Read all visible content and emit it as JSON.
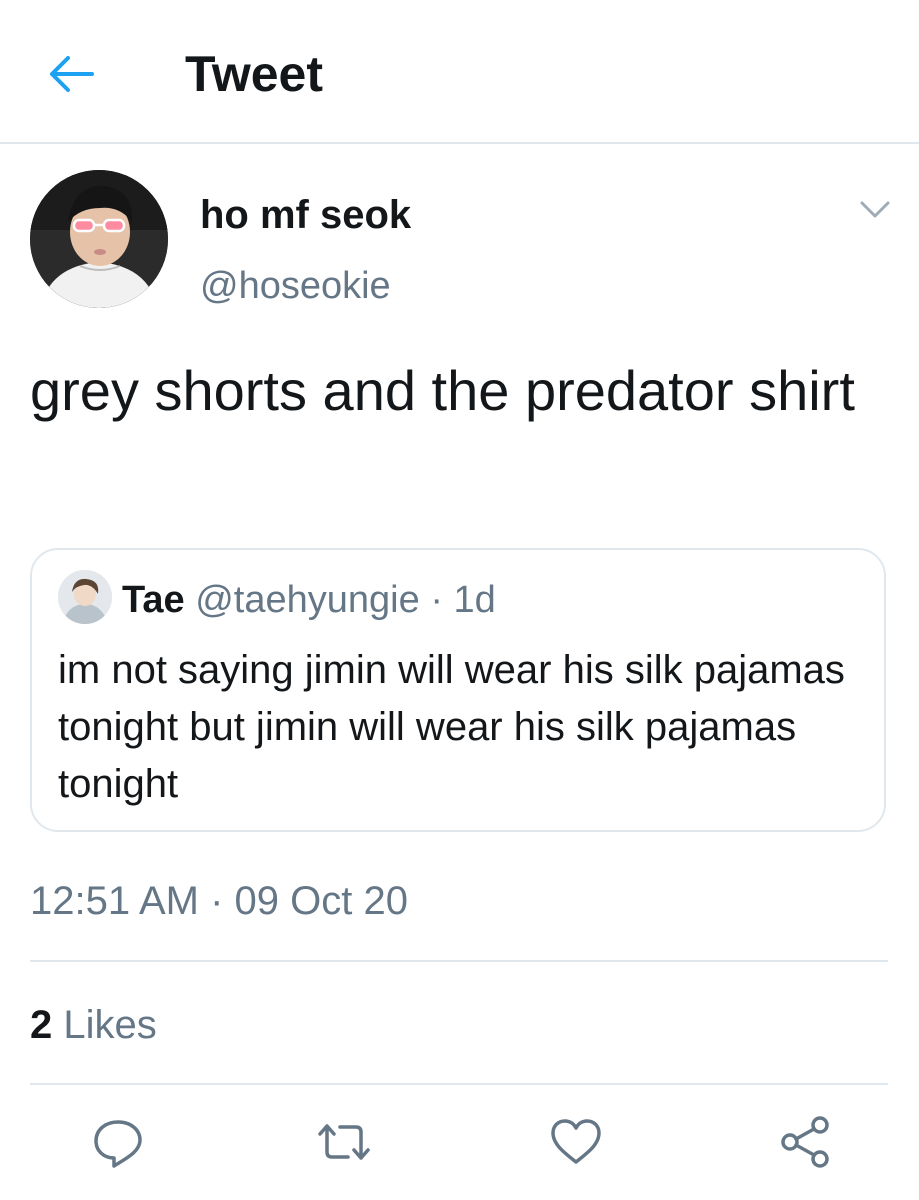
{
  "header": {
    "title": "Tweet"
  },
  "author": {
    "display_name": "ho mf seok",
    "handle": "@hoseokie"
  },
  "tweet": {
    "text": "grey shorts and the predator shirt"
  },
  "quoted": {
    "name": "Tae",
    "handle": "@taehyungie",
    "separator": "·",
    "age": "1d",
    "text": "im not saying jimin will wear his silk pajamas tonight but jimin will wear his silk pajamas tonight"
  },
  "timestamp": "12:51 AM · 09 Oct 20",
  "stats": {
    "likes_count": "2",
    "likes_label": "Likes"
  },
  "icons": {
    "back": "arrow-left-icon",
    "caret": "chevron-down-icon",
    "reply": "reply-icon",
    "retweet": "retweet-icon",
    "like": "heart-icon",
    "share": "share-icon"
  },
  "colors": {
    "accent": "#1da1f2",
    "secondary_text": "#657786",
    "divider": "#e1e8ed"
  }
}
